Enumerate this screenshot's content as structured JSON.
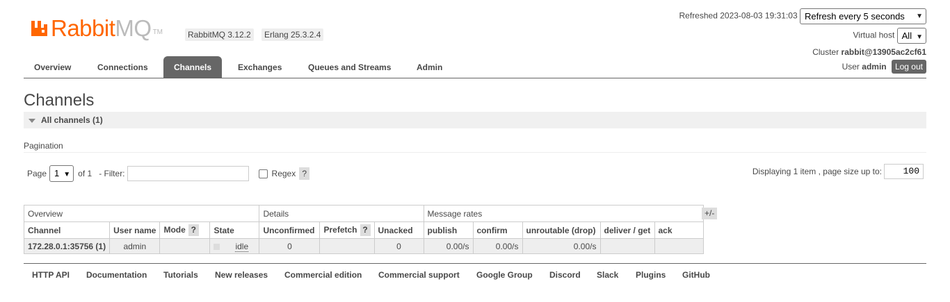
{
  "header": {
    "logo_part1": "Rabbit",
    "logo_part2": "MQ",
    "logo_tm": "TM",
    "rabbitmq_version": "RabbitMQ 3.12.2",
    "erlang_version": "Erlang 25.3.2.4",
    "refreshed_label": "Refreshed 2023-08-03 19:31:03",
    "refresh_select": "Refresh every 5 seconds",
    "vhost_label": "Virtual host",
    "vhost_select": "All",
    "cluster_label": "Cluster",
    "cluster_name": "rabbit@13905ac2cf61",
    "user_label": "User",
    "user_name": "admin",
    "logout_label": "Log out"
  },
  "tabs": [
    {
      "label": "Overview"
    },
    {
      "label": "Connections"
    },
    {
      "label": "Channels"
    },
    {
      "label": "Exchanges"
    },
    {
      "label": "Queues and Streams"
    },
    {
      "label": "Admin"
    }
  ],
  "page_title": "Channels",
  "section_title": "All channels (1)",
  "pagination": {
    "label": "Pagination",
    "page_label": "Page",
    "page_value": "1",
    "of_label": "of 1",
    "filter_label": "- Filter:",
    "filter_value": "",
    "regex_label": "Regex",
    "help": "?",
    "display_info": "Displaying 1 item , page size up to:",
    "page_size": "100"
  },
  "table": {
    "groups": [
      "Overview",
      "Details",
      "Message rates"
    ],
    "plusminus": "+/-",
    "columns": {
      "channel": "Channel",
      "user_name": "User name",
      "mode": "Mode",
      "state": "State",
      "unconfirmed": "Unconfirmed",
      "prefetch": "Prefetch",
      "unacked": "Unacked",
      "publish": "publish",
      "confirm": "confirm",
      "unroutable": "unroutable (drop)",
      "deliver_get": "deliver / get",
      "ack": "ack"
    },
    "rows": [
      {
        "channel": "172.28.0.1:35756 (1)",
        "user_name": "admin",
        "mode": "",
        "state": "idle",
        "unconfirmed": "0",
        "prefetch": "",
        "unacked": "0",
        "publish": "0.00/s",
        "confirm": "0.00/s",
        "unroutable": "0.00/s",
        "deliver_get": "",
        "ack": ""
      }
    ]
  },
  "footer": [
    {
      "label": "HTTP API"
    },
    {
      "label": "Documentation"
    },
    {
      "label": "Tutorials"
    },
    {
      "label": "New releases"
    },
    {
      "label": "Commercial edition"
    },
    {
      "label": "Commercial support"
    },
    {
      "label": "Google Group"
    },
    {
      "label": "Discord"
    },
    {
      "label": "Slack"
    },
    {
      "label": "Plugins"
    },
    {
      "label": "GitHub"
    }
  ],
  "colors": {
    "brand": "#ff6600",
    "logo_gray": "#bbbbbb",
    "active_tab": "#666666",
    "text": "#484848"
  }
}
